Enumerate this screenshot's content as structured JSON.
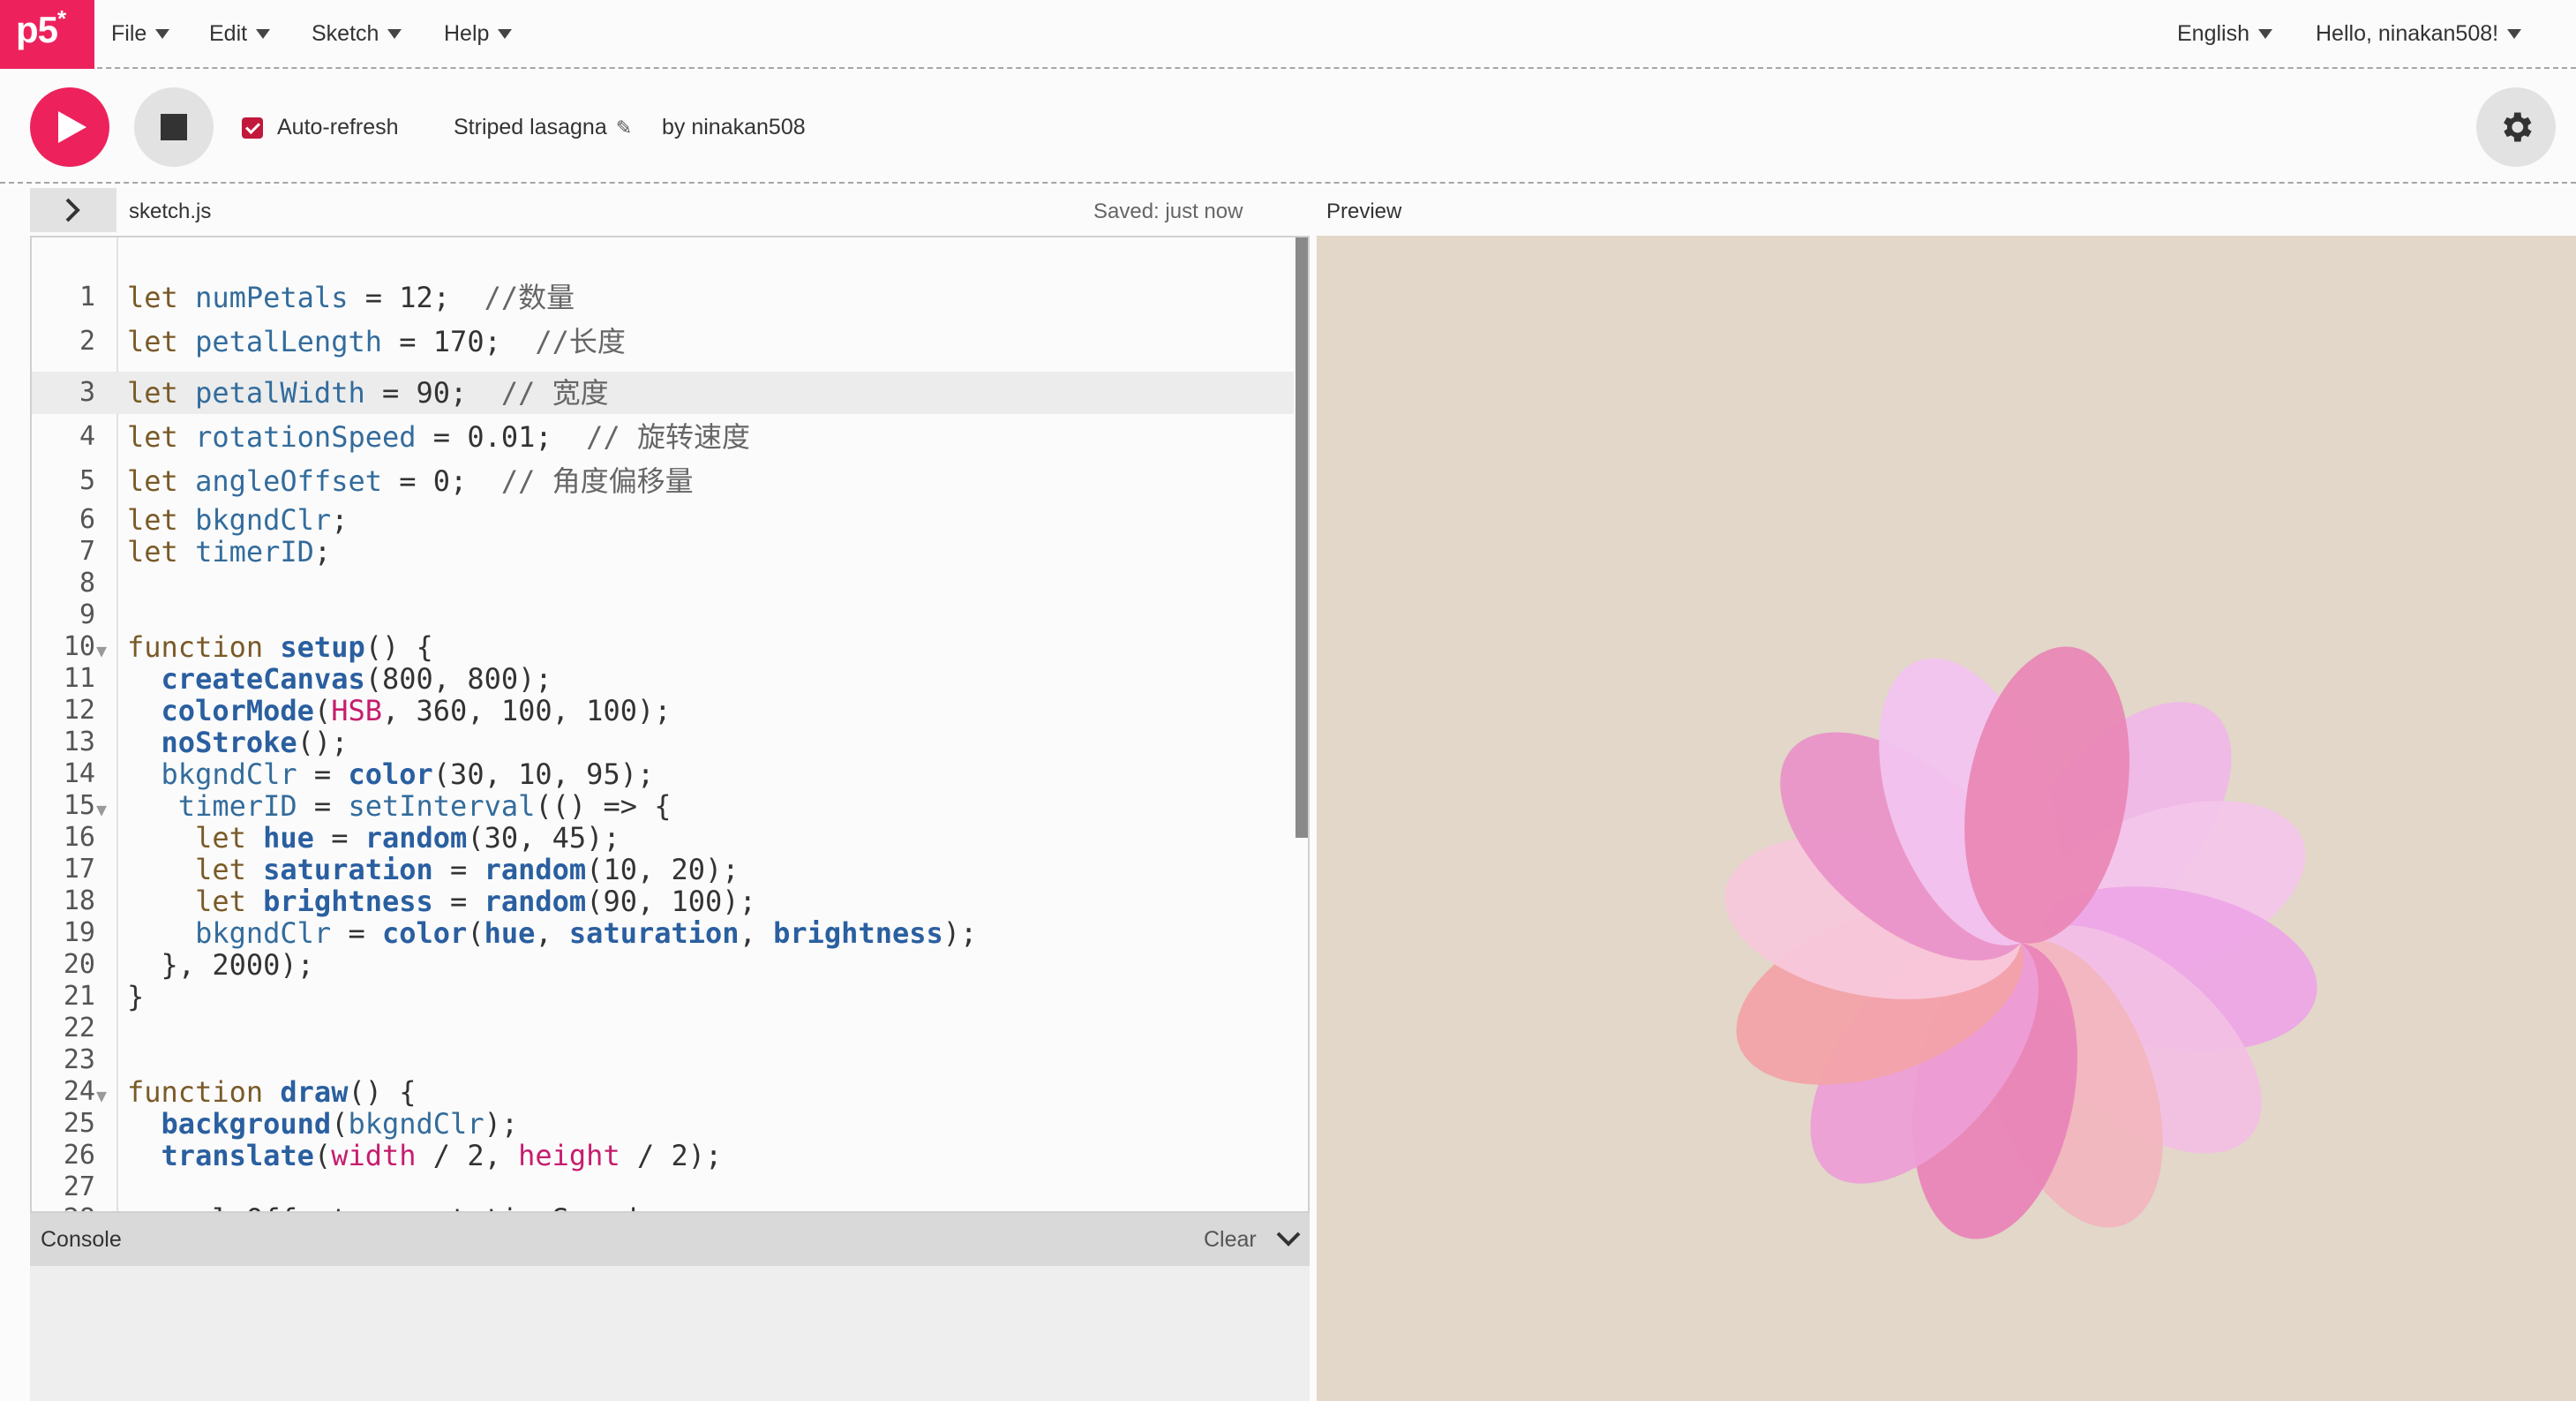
{
  "nav": {
    "logo": "p5",
    "logo_sup": "*",
    "menus": [
      "File",
      "Edit",
      "Sketch",
      "Help"
    ],
    "language": "English",
    "user_greeting": "Hello, ninakan508!"
  },
  "toolbar": {
    "auto_refresh_label": "Auto-refresh",
    "auto_refresh_checked": true,
    "sketch_name": "Striped lasagna",
    "byline": "by ninakan508"
  },
  "editor": {
    "file_name": "sketch.js",
    "save_status": "Saved: just now",
    "active_line": 3,
    "lines": [
      {
        "n": "1",
        "html_key": "l1"
      },
      {
        "n": "2",
        "html_key": "l2"
      }
    ]
  },
  "code": {
    "l1": [
      "let ",
      "numPetals",
      " = 12;  ",
      "//数量"
    ],
    "l2": [
      "let ",
      "petalLength",
      " = 170;  ",
      "//长度"
    ],
    "l3": [
      "let ",
      "petalWidth",
      " = 90;  ",
      "// 宽度"
    ],
    "l4": [
      "let ",
      "rotationSpeed",
      " = 0.01;  ",
      "// 旋转速度"
    ],
    "l5": [
      "let ",
      "angleOffset",
      " = 0;  ",
      "// 角度偏移量"
    ],
    "l6": [
      "let ",
      "bkgndClr",
      ";"
    ],
    "l7": [
      "let ",
      "timerID",
      ";"
    ],
    "l10": [
      "function ",
      "setup",
      "() {"
    ],
    "l11": [
      "  ",
      "createCanvas",
      "(800, 800);"
    ],
    "l12": [
      "  ",
      "colorMode",
      "(",
      "HSB",
      ", 360, 100, 100);"
    ],
    "l13": [
      "  ",
      "noStroke",
      "();"
    ],
    "l14": [
      "  ",
      "bkgndClr",
      " = ",
      "color",
      "(30, 10, 95);"
    ],
    "l15": [
      "   ",
      "timerID",
      " = ",
      "setInterval",
      "(() => {"
    ],
    "l16": [
      "    let ",
      "hue",
      " = ",
      "random",
      "(30, 45);"
    ],
    "l17": [
      "    let ",
      "saturation",
      " = ",
      "random",
      "(10, 20);"
    ],
    "l18": [
      "    let ",
      "brightness",
      " = ",
      "random",
      "(90, 100);"
    ],
    "l19": [
      "    ",
      "bkgndClr",
      " = ",
      "color",
      "(",
      "hue",
      ", ",
      "saturation",
      ", ",
      "brightness",
      ");"
    ],
    "l20": [
      "  }, 2000);"
    ],
    "l21": [
      "}"
    ],
    "l24": [
      "function ",
      "draw",
      "() {"
    ],
    "l25": [
      "  ",
      "background",
      "(",
      "bkgndClr",
      ");"
    ],
    "l26": [
      "  ",
      "translate",
      "(",
      "width",
      " / 2, ",
      "height",
      " / 2);"
    ],
    "l28": [
      "  angleOffset += rotationSpeed;"
    ]
  },
  "console": {
    "title": "Console",
    "clear_label": "Clear"
  },
  "preview": {
    "label": "Preview",
    "background": "#e2d7c8",
    "petal_count": 12,
    "petal_colors": [
      "#f0b8e8",
      "#f4c6ea",
      "#eda6e6",
      "#f3c0e4",
      "#f2b6be",
      "#e983b8",
      "#ed9ed6",
      "#f3a2a8",
      "#f7c8dc",
      "#ea92c8",
      "#f2c4f0",
      "#ea87b6"
    ]
  },
  "colors": {
    "accent": "#ed225d",
    "checkbox": "#c2183c"
  }
}
